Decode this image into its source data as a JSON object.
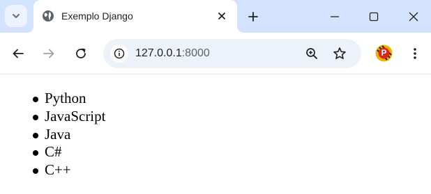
{
  "colors": {
    "tabstrip_bg": "#d3e3fd",
    "omnibox_bg": "#edf2fa",
    "icon": "#1f1f1f",
    "icon_disabled": "#9aa0a6",
    "profile_ring": "#e8b400",
    "profile_fill": "#e0231b"
  },
  "tab": {
    "title": "Exemplo Django",
    "favicon": "globe-icon"
  },
  "omnibox": {
    "url_host": "127.0.0.1",
    "url_port": ":8000"
  },
  "profile": {
    "initial": "P"
  },
  "page": {
    "items": [
      "Python",
      "JavaScript",
      "Java",
      "C#",
      "C++"
    ]
  }
}
